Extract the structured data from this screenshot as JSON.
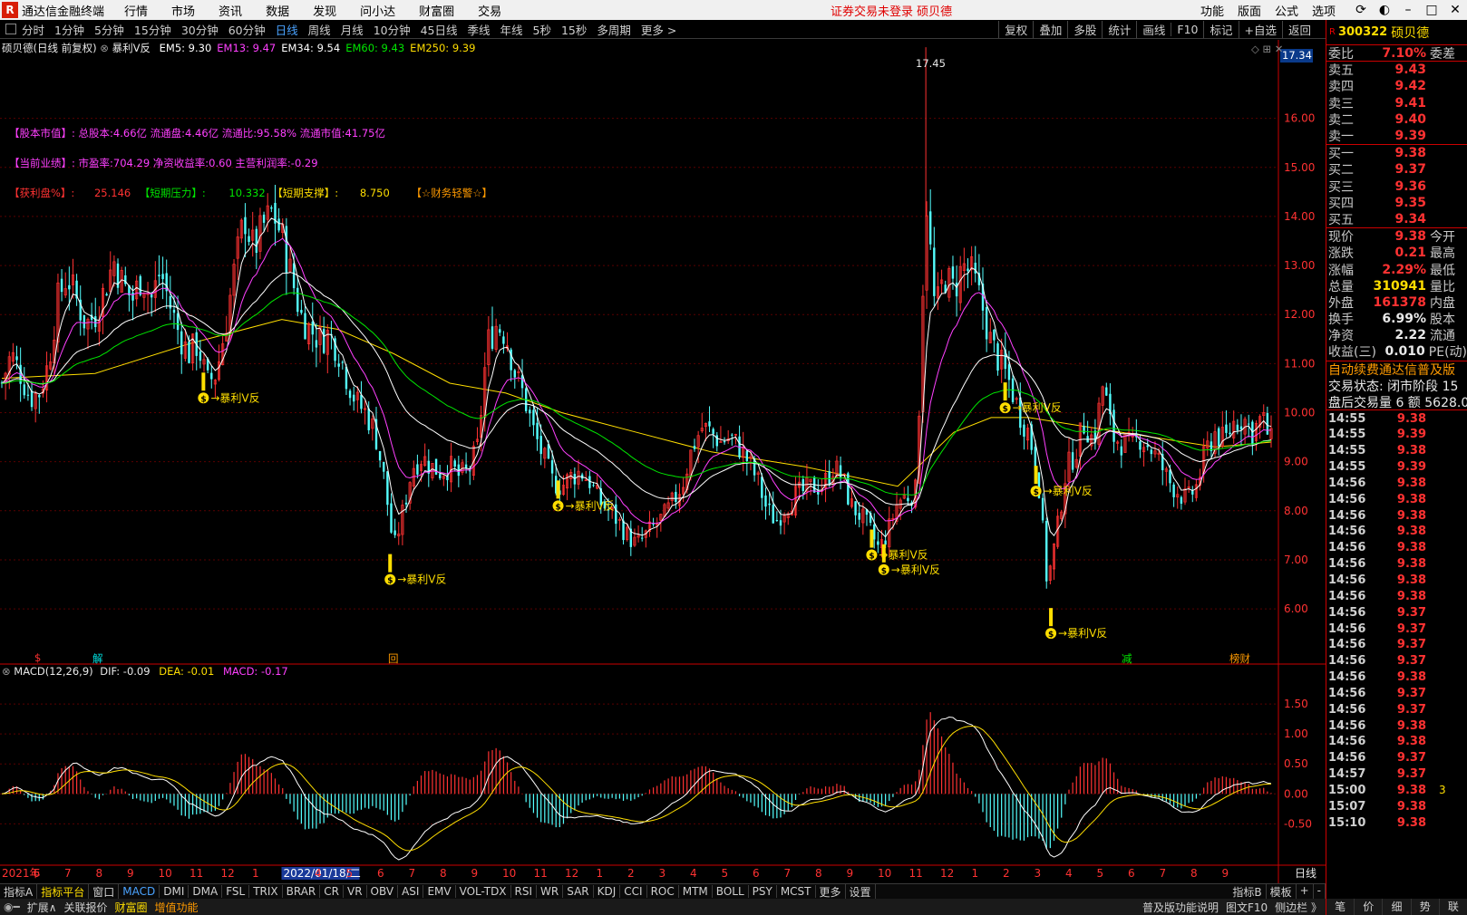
{
  "app": {
    "logo_text": "R",
    "name": "通达信金融终端",
    "menu": [
      "行情",
      "市场",
      "资讯",
      "数据",
      "发现",
      "问小达",
      "财富圈",
      "交易"
    ],
    "notice": "证券交易未登录  硕贝德",
    "right_menu": [
      "功能",
      "版面",
      "公式",
      "选项"
    ]
  },
  "periods": {
    "items": [
      "分时",
      "1分钟",
      "5分钟",
      "15分钟",
      "30分钟",
      "60分钟",
      "日线",
      "周线",
      "月线",
      "10分钟",
      "45日线",
      "季线",
      "年线",
      "5秒",
      "15秒",
      "多周期",
      "更多 >"
    ],
    "active": "日线"
  },
  "right_tools": [
    "复权",
    "叠加",
    "多股",
    "统计",
    "画线",
    "F10",
    "标记",
    "+自选",
    "返回"
  ],
  "main_chart": {
    "title": "硕贝德(日线 前复权)",
    "formula": "暴利V反",
    "ma": [
      {
        "label": "EM5: 9.30",
        "color": "#ffffff"
      },
      {
        "label": "EM13: 9.47",
        "color": "#ff40ff"
      },
      {
        "label": "EM34: 9.54",
        "color": "#ffffff"
      },
      {
        "label": "EM60: 9.43",
        "color": "#00e600"
      },
      {
        "label": "EM250: 9.39",
        "color": "#ffde00"
      }
    ],
    "info1": "【股本市值】: 总股本:4.66亿 流通盘:4.46亿 流通比:95.58% 流通市值:41.75亿",
    "info2": "【当前业绩】: 市盈率:704.29 净资收益率:0.60 主营利润率:-0.29",
    "info3_label1": "【获利盘%】:",
    "info3_val1": "25.146",
    "info3_label2": "【短期压力】:",
    "info3_val2": "10.332",
    "info3_label3": "【短期支撑】:",
    "info3_val3": "8.750",
    "info3_label4": "【☆财务轻警☆】",
    "high_label": "17.45",
    "cursor_price": "17.34",
    "signal_label": "暴利V反",
    "event_markers": [
      "$",
      "解",
      "回",
      "减",
      "榜财"
    ]
  },
  "chart_data": [
    {
      "type": "candlestick",
      "title": "硕贝德(日线 前复权)",
      "ylim": [
        5.3,
        17.6
      ],
      "y_ticks": [
        6.0,
        7.0,
        8.0,
        9.0,
        10.0,
        11.0,
        12.0,
        13.0,
        14.0,
        15.0,
        16.0
      ],
      "x_labels": [
        "2021年",
        "6",
        "7",
        "8",
        "9",
        "10",
        "11",
        "12",
        "1",
        "2022/01/18/二",
        "4",
        "5",
        "6",
        "7",
        "8",
        "9",
        "10",
        "11",
        "12",
        "1",
        "2",
        "3",
        "4",
        "5",
        "6",
        "7",
        "8",
        "9",
        "10",
        "11",
        "12",
        "1",
        "2",
        "3",
        "4",
        "5",
        "6",
        "7",
        "8",
        "9",
        "日线"
      ],
      "close_path": [
        [
          0,
          10.6
        ],
        [
          10,
          11.2
        ],
        [
          20,
          10.8
        ],
        [
          30,
          10.3
        ],
        [
          40,
          10.4
        ],
        [
          50,
          11.0
        ],
        [
          60,
          12.3
        ],
        [
          70,
          12.8
        ],
        [
          80,
          12.3
        ],
        [
          90,
          11.8
        ],
        [
          100,
          12.0
        ],
        [
          110,
          12.5
        ],
        [
          120,
          13.1
        ],
        [
          130,
          12.6
        ],
        [
          140,
          12.3
        ],
        [
          150,
          12.8
        ],
        [
          160,
          12.3
        ],
        [
          170,
          12.9
        ],
        [
          180,
          12.2
        ],
        [
          190,
          11.6
        ],
        [
          200,
          11.2
        ],
        [
          210,
          11.4
        ],
        [
          220,
          10.6
        ],
        [
          230,
          10.8
        ],
        [
          240,
          11.8
        ],
        [
          250,
          13.0
        ],
        [
          260,
          14.0
        ],
        [
          270,
          13.3
        ],
        [
          280,
          13.8
        ],
        [
          290,
          14.1
        ],
        [
          300,
          13.6
        ],
        [
          310,
          12.8
        ],
        [
          320,
          12.0
        ],
        [
          330,
          11.7
        ],
        [
          340,
          11.5
        ],
        [
          350,
          11.6
        ],
        [
          360,
          11.3
        ],
        [
          370,
          10.7
        ],
        [
          380,
          10.2
        ],
        [
          390,
          10.0
        ],
        [
          400,
          9.6
        ],
        [
          410,
          8.6
        ],
        [
          420,
          7.2
        ],
        [
          430,
          8.0
        ],
        [
          440,
          8.9
        ],
        [
          450,
          9.1
        ],
        [
          460,
          8.9
        ],
        [
          470,
          8.8
        ],
        [
          480,
          8.9
        ],
        [
          490,
          8.7
        ],
        [
          500,
          8.8
        ],
        [
          510,
          9.3
        ],
        [
          520,
          11.4
        ],
        [
          530,
          11.8
        ],
        [
          540,
          11.6
        ],
        [
          550,
          10.8
        ],
        [
          560,
          10.3
        ],
        [
          570,
          9.6
        ],
        [
          580,
          9.1
        ],
        [
          590,
          8.6
        ],
        [
          600,
          8.5
        ],
        [
          610,
          8.7
        ],
        [
          620,
          8.8
        ],
        [
          630,
          8.6
        ],
        [
          640,
          8.2
        ],
        [
          650,
          8.0
        ],
        [
          660,
          7.8
        ],
        [
          670,
          7.5
        ],
        [
          680,
          7.3
        ],
        [
          690,
          7.5
        ],
        [
          700,
          7.7
        ],
        [
          710,
          7.9
        ],
        [
          720,
          8.2
        ],
        [
          730,
          8.6
        ],
        [
          740,
          9.3
        ],
        [
          750,
          9.7
        ],
        [
          760,
          9.6
        ],
        [
          770,
          9.4
        ],
        [
          780,
          9.5
        ],
        [
          790,
          9.3
        ],
        [
          800,
          9.0
        ],
        [
          810,
          8.6
        ],
        [
          820,
          8.0
        ],
        [
          830,
          7.8
        ],
        [
          840,
          8.1
        ],
        [
          850,
          8.3
        ],
        [
          860,
          8.4
        ],
        [
          870,
          8.5
        ],
        [
          880,
          8.5
        ],
        [
          890,
          8.9
        ],
        [
          900,
          8.7
        ],
        [
          910,
          8.1
        ],
        [
          920,
          7.9
        ],
        [
          930,
          7.6
        ],
        [
          940,
          7.2
        ],
        [
          950,
          7.6
        ],
        [
          960,
          8.2
        ],
        [
          970,
          8.3
        ],
        [
          980,
          8.4
        ],
        [
          990,
          14.5
        ],
        [
          1000,
          12.0
        ],
        [
          1010,
          12.8
        ],
        [
          1020,
          12.5
        ],
        [
          1030,
          13.0
        ],
        [
          1040,
          12.8
        ],
        [
          1050,
          12.2
        ],
        [
          1060,
          11.4
        ],
        [
          1070,
          11.0
        ],
        [
          1080,
          10.6
        ],
        [
          1090,
          10.0
        ],
        [
          1100,
          9.6
        ],
        [
          1110,
          8.8
        ],
        [
          1120,
          6.5
        ],
        [
          1130,
          7.5
        ],
        [
          1140,
          8.8
        ],
        [
          1150,
          9.2
        ],
        [
          1160,
          9.8
        ],
        [
          1170,
          9.4
        ],
        [
          1180,
          10.6
        ],
        [
          1190,
          9.5
        ],
        [
          1200,
          9.4
        ],
        [
          1210,
          9.3
        ],
        [
          1220,
          9.5
        ],
        [
          1230,
          9.3
        ],
        [
          1240,
          9.0
        ],
        [
          1250,
          8.6
        ],
        [
          1260,
          8.4
        ],
        [
          1270,
          8.2
        ],
        [
          1280,
          8.5
        ],
        [
          1290,
          9.2
        ],
        [
          1300,
          9.6
        ],
        [
          1310,
          9.4
        ],
        [
          1320,
          9.8
        ],
        [
          1330,
          9.9
        ],
        [
          1340,
          9.6
        ],
        [
          1350,
          9.9
        ],
        [
          1360,
          9.4
        ]
      ],
      "ema250_path": [
        [
          0,
          10.7
        ],
        [
          100,
          10.8
        ],
        [
          200,
          11.4
        ],
        [
          300,
          11.9
        ],
        [
          360,
          11.7
        ],
        [
          420,
          11.2
        ],
        [
          480,
          10.6
        ],
        [
          540,
          10.4
        ],
        [
          600,
          10.0
        ],
        [
          680,
          9.6
        ],
        [
          760,
          9.2
        ],
        [
          860,
          8.9
        ],
        [
          960,
          8.5
        ],
        [
          1020,
          9.6
        ],
        [
          1060,
          9.9
        ],
        [
          1100,
          9.9
        ],
        [
          1200,
          9.6
        ],
        [
          1300,
          9.3
        ],
        [
          1360,
          9.4
        ]
      ],
      "signals": [
        {
          "x": 216,
          "price": 10.3
        },
        {
          "x": 416,
          "price": 6.6
        },
        {
          "x": 596,
          "price": 8.1
        },
        {
          "x": 932,
          "price": 7.1
        },
        {
          "x": 945,
          "price": 6.8
        },
        {
          "x": 1075,
          "price": 10.1
        },
        {
          "x": 1108,
          "price": 8.4
        },
        {
          "x": 1124,
          "price": 5.5
        }
      ]
    },
    {
      "type": "bar",
      "title": "MACD(12,26,9)",
      "series": [
        {
          "name": "DIF",
          "last": -0.09
        },
        {
          "name": "DEA",
          "last": -0.01
        },
        {
          "name": "MACD",
          "last": -0.17
        }
      ],
      "ylim": [
        -1.1,
        2.0
      ],
      "y_ticks": [
        -0.5,
        0.0,
        0.5,
        1.0,
        1.5
      ]
    }
  ],
  "macd_header": {
    "title": "MACD(12,26,9)",
    "dif": "DIF: -0.09",
    "dea": "DEA: -0.01",
    "macd": "MACD: -0.17"
  },
  "quote": {
    "r": "R",
    "code": "300322",
    "name": "硕贝德",
    "weibi_label": "委比",
    "weibi": "7.10%",
    "weicha_label": "委差",
    "sell": [
      {
        "label": "卖五",
        "price": "9.43"
      },
      {
        "label": "卖四",
        "price": "9.42"
      },
      {
        "label": "卖三",
        "price": "9.41"
      },
      {
        "label": "卖二",
        "price": "9.40"
      },
      {
        "label": "卖一",
        "price": "9.39"
      }
    ],
    "buy": [
      {
        "label": "买一",
        "price": "9.38"
      },
      {
        "label": "买二",
        "price": "9.37"
      },
      {
        "label": "买三",
        "price": "9.36"
      },
      {
        "label": "买四",
        "price": "9.35"
      },
      {
        "label": "买五",
        "price": "9.34"
      }
    ],
    "stats": [
      {
        "label": "现价",
        "value": "9.38",
        "extra": "今开",
        "cls": "red"
      },
      {
        "label": "涨跌",
        "value": "0.21",
        "extra": "最高",
        "cls": "red"
      },
      {
        "label": "涨幅",
        "value": "2.29%",
        "extra": "最低",
        "cls": "red"
      },
      {
        "label": "总量",
        "value": "310941",
        "extra": "量比",
        "cls": "yellow"
      },
      {
        "label": "外盘",
        "value": "161378",
        "extra": "内盘",
        "cls": "red"
      },
      {
        "label": "换手",
        "value": "6.99%",
        "extra": "股本",
        "cls": "white"
      },
      {
        "label": "净资",
        "value": "2.22",
        "extra": "流通",
        "cls": "white"
      },
      {
        "label": "收益(三)",
        "value": "0.010",
        "extra": "PE(动)",
        "cls": "white"
      }
    ],
    "promo": "自动续费通达信普及版",
    "trade_status": "交易状态: 闭市阶段 15",
    "after_hours": "盘后交易量 6 额 5628.0",
    "ticks": [
      {
        "t": "14:55",
        "p": "9.38",
        "cls": "red"
      },
      {
        "t": "14:55",
        "p": "9.39",
        "cls": "red"
      },
      {
        "t": "14:55",
        "p": "9.38",
        "cls": "red"
      },
      {
        "t": "14:55",
        "p": "9.39",
        "cls": "red"
      },
      {
        "t": "14:56",
        "p": "9.38",
        "cls": "red"
      },
      {
        "t": "14:56",
        "p": "9.38",
        "cls": "red"
      },
      {
        "t": "14:56",
        "p": "9.38",
        "cls": "red"
      },
      {
        "t": "14:56",
        "p": "9.38",
        "cls": "red"
      },
      {
        "t": "14:56",
        "p": "9.38",
        "cls": "red"
      },
      {
        "t": "14:56",
        "p": "9.38",
        "cls": "red"
      },
      {
        "t": "14:56",
        "p": "9.38",
        "cls": "red"
      },
      {
        "t": "14:56",
        "p": "9.38",
        "cls": "red"
      },
      {
        "t": "14:56",
        "p": "9.37",
        "cls": "red"
      },
      {
        "t": "14:56",
        "p": "9.37",
        "cls": "red"
      },
      {
        "t": "14:56",
        "p": "9.37",
        "cls": "red"
      },
      {
        "t": "14:56",
        "p": "9.37",
        "cls": "red"
      },
      {
        "t": "14:56",
        "p": "9.38",
        "cls": "red"
      },
      {
        "t": "14:56",
        "p": "9.37",
        "cls": "red"
      },
      {
        "t": "14:56",
        "p": "9.37",
        "cls": "red"
      },
      {
        "t": "14:56",
        "p": "9.38",
        "cls": "red"
      },
      {
        "t": "14:56",
        "p": "9.38",
        "cls": "red"
      },
      {
        "t": "14:56",
        "p": "9.37",
        "cls": "red"
      },
      {
        "t": "14:57",
        "p": "9.37",
        "cls": "red"
      },
      {
        "t": "15:00",
        "p": "9.38",
        "cls": "red",
        "vol": "3"
      },
      {
        "t": "15:07",
        "p": "9.38",
        "cls": "red"
      },
      {
        "t": "15:10",
        "p": "9.38",
        "cls": "red"
      }
    ]
  },
  "indicator_tabs": {
    "items": [
      "指标A",
      "指标平台",
      "窗口",
      "MACD",
      "DMI",
      "DMA",
      "FSL",
      "TRIX",
      "BRAR",
      "CR",
      "VR",
      "OBV",
      "ASI",
      "EMV",
      "VOL-TDX",
      "RSI",
      "WR",
      "SAR",
      "KDJ",
      "CCI",
      "ROC",
      "MTM",
      "BOLL",
      "PSY",
      "MCST",
      "更多",
      "设置"
    ],
    "right": [
      "指标B",
      "模板",
      "+",
      "-"
    ]
  },
  "status": {
    "items": [
      "扩展∧",
      "关联报价",
      "财富圈",
      "增值功能"
    ],
    "right": [
      "普及版功能说明",
      "图文F10",
      "侧边栏 》"
    ],
    "quote_tabs": [
      "笔",
      "价",
      "细",
      "势",
      "联"
    ]
  }
}
